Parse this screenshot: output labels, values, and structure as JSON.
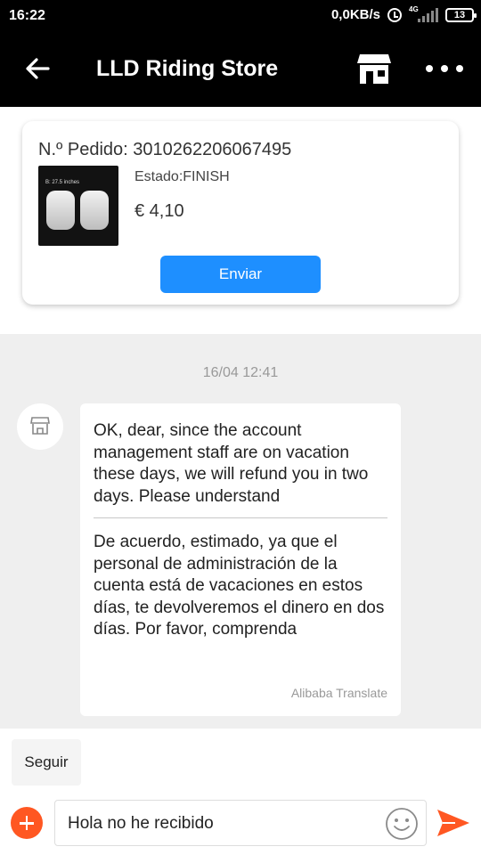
{
  "status_bar": {
    "time": "16:22",
    "network_speed": "0,0KB/s",
    "network_type": "4G",
    "battery": "13"
  },
  "header": {
    "title": "LLD Riding Store",
    "icons": [
      "back-arrow-icon",
      "store-icon",
      "more-icon"
    ]
  },
  "order": {
    "number_label": "N.º Pedido: 3010262206067495",
    "image_caption": "B: 27.5 inches",
    "status": "Estado:FINISH",
    "price": "€ 4,10",
    "send_button": "Enviar"
  },
  "chat": {
    "timestamp": "16/04 12:41",
    "message": {
      "original": "OK, dear, since the account management staff are on vacation these days, we will refund you in two days. Please understand",
      "translated": "De acuerdo, estimado, ya que el personal de administración de la cuenta está de vacaciones en estos días, te devolveremos el dinero en dos días. Por favor, comprenda",
      "translator": "Alibaba Translate"
    }
  },
  "composer": {
    "quick_reply": "Seguir",
    "input_value": "Hola no he recibido"
  },
  "colors": {
    "accent_blue": "#1e8fff",
    "accent_orange": "#ff5722",
    "chat_background": "#efefef"
  }
}
